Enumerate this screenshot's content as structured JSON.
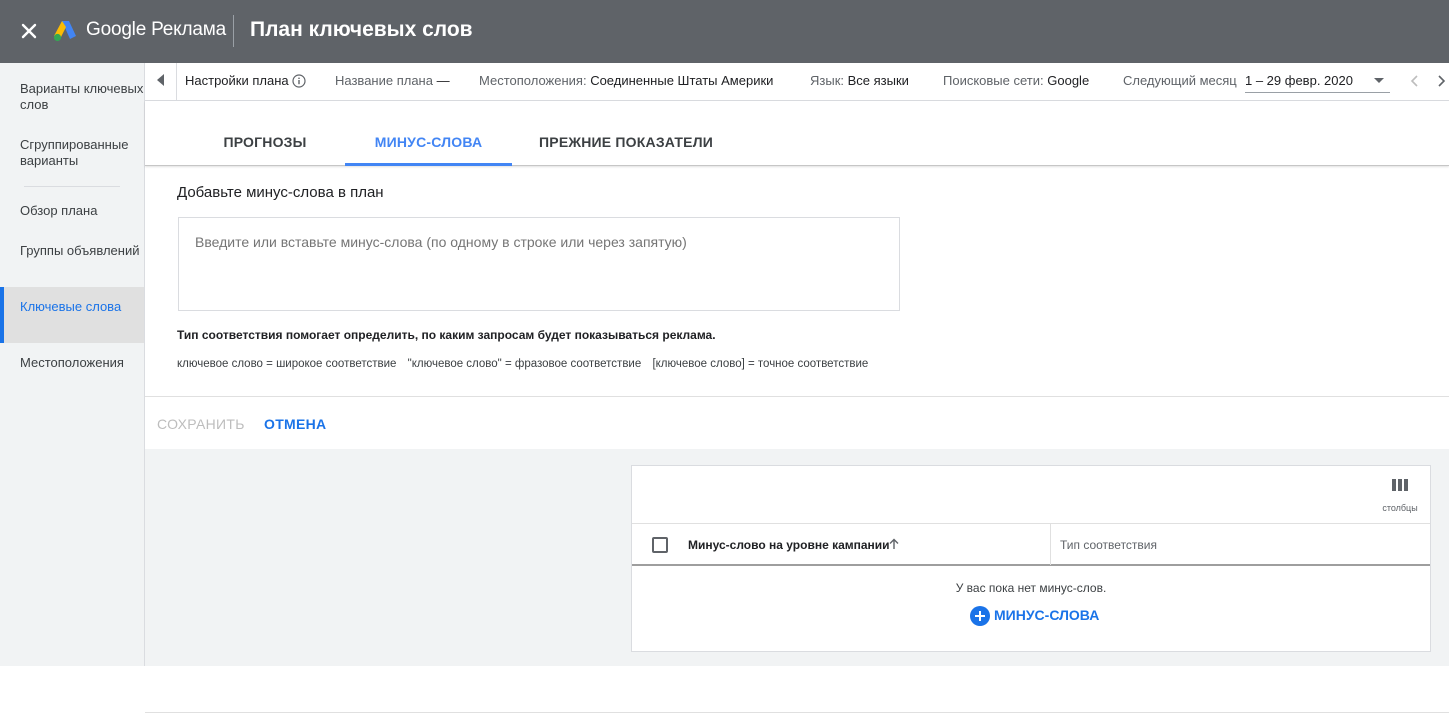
{
  "header": {
    "brand": "Google Реклама",
    "title": "План ключевых слов"
  },
  "sidebar": {
    "items": [
      {
        "label": "Варианты ключевых слов"
      },
      {
        "label": "Сгруппированные варианты"
      },
      {
        "label": "Обзор плана"
      },
      {
        "label": "Группы объявлений"
      },
      {
        "label": "Ключевые слова"
      },
      {
        "label": "Местоположения"
      }
    ],
    "active_index": 4
  },
  "settings": {
    "plan_settings": "Настройки плана",
    "plan_name_label": "Название плана",
    "plan_name_value": "—",
    "locations_label": "Местоположения:",
    "locations_value": "Соединенные Штаты Америки",
    "language_label": "Язык:",
    "language_value": "Все языки",
    "networks_label": "Поисковые сети:",
    "networks_value": "Google",
    "period_label": "Следующий месяц",
    "period_value": "1 – 29 февр. 2020"
  },
  "tabs": [
    {
      "label": "ПРОГНОЗЫ"
    },
    {
      "label": "МИНУС-СЛОВА"
    },
    {
      "label": "ПРЕЖНИЕ ПОКАЗАТЕЛИ"
    }
  ],
  "active_tab": 1,
  "form": {
    "title": "Добавьте минус-слова в план",
    "placeholder": "Введите или вставьте минус-слова (по одному в строке или через запятую)",
    "value": "",
    "match_help": "Тип соответствия помогает определить, по каким запросам будет показываться реклама.",
    "examples": [
      "ключевое слово = широкое соответствие",
      "\"ключевое слово\" = фразовое соответствие",
      "[ключевое слово] = точное соответствие"
    ],
    "save_label": "СОХРАНИТЬ",
    "cancel_label": "ОТМЕНА"
  },
  "table": {
    "columns_label": "столбцы",
    "col_keyword": "Минус-слово на уровне кампании",
    "col_match": "Тип соответствия",
    "empty_message": "У вас пока нет минус-слов.",
    "add_label": "МИНУС-СЛОВА"
  },
  "colors": {
    "accent": "#1a73e8",
    "topbar": "#5f6368"
  }
}
